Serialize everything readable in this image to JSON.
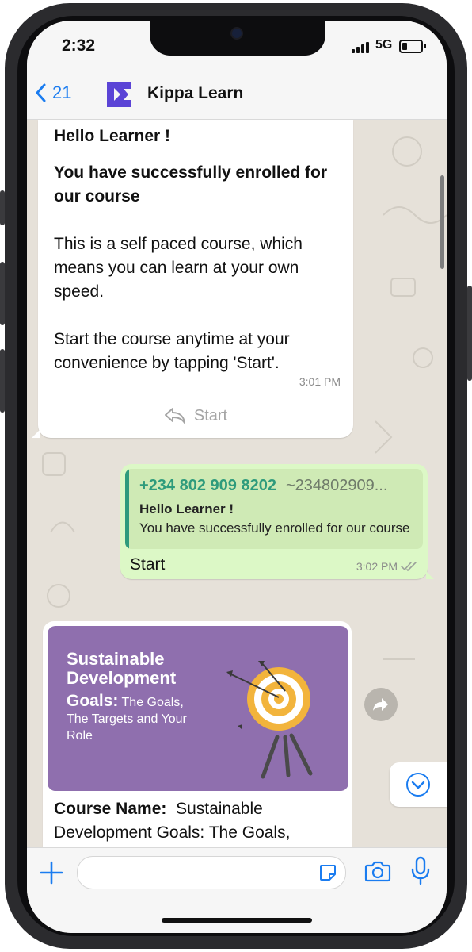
{
  "status_bar": {
    "time": "2:32",
    "network": "5G"
  },
  "header": {
    "back_count": "21",
    "chat_name": "Kippa Learn",
    "avatar_letter": "K",
    "brand_color": "#5b44d6"
  },
  "messages": {
    "incoming_1": {
      "greeting": "Hello Learner !",
      "enrolled": "You have successfully enrolled for our course",
      "paragraph_1": "This is a self paced course, which means you can learn at your own speed.",
      "paragraph_2": "Start the course anytime at your convenience by tapping 'Start'.",
      "time": "3:01 PM",
      "reply_button": "Start"
    },
    "outgoing_1": {
      "quoted_phone": "+234 802 909 8202",
      "quoted_alias": "~234802909...",
      "quoted_line_1": "Hello Learner !",
      "quoted_line_2": "You have successfully enrolled for our course",
      "text": "Start",
      "time": "3:02 PM"
    },
    "incoming_2": {
      "image_title_bold": "Sustainable Development",
      "image_title_goals": "Goals:",
      "image_title_rest": "The Goals, The Targets and Your Role",
      "course_label": "Course Name:",
      "course_value": "Sustainable Development Goals: The Goals,"
    }
  },
  "icons": [
    "chevron-left-icon",
    "plus-icon",
    "sticker-icon",
    "camera-icon",
    "microphone-icon",
    "forward-icon",
    "chevron-down-circle-icon",
    "reply-icon",
    "double-check-icon"
  ],
  "colors": {
    "accent_blue": "#1a7cf0",
    "outgoing_bubble": "#dcf8c6",
    "quote_green": "#2e9b7c",
    "image_purple": "#8f6fae"
  }
}
